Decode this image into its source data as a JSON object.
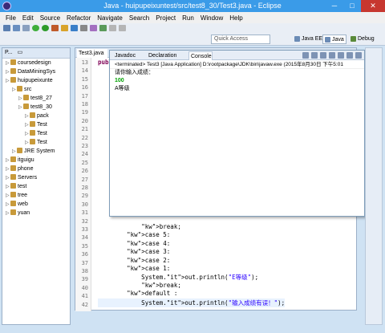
{
  "window": {
    "title": "Java - huipupeixuntest/src/test8_30/Test3.java - Eclipse"
  },
  "menu": [
    "File",
    "Edit",
    "Source",
    "Refactor",
    "Navigate",
    "Search",
    "Project",
    "Run",
    "Window",
    "Help"
  ],
  "quick_access": {
    "placeholder": "Quick Access"
  },
  "perspectives": {
    "java_ee": "Java EE",
    "java": "Java",
    "debug": "Debug"
  },
  "left_panel": {
    "tab": "P...",
    "tree": [
      {
        "label": "coursedesign",
        "indent": 0
      },
      {
        "label": "DataMiningSys",
        "indent": 0
      },
      {
        "label": "huipupeixunte",
        "indent": 0
      },
      {
        "label": "src",
        "indent": 1
      },
      {
        "label": "test8_27",
        "indent": 2
      },
      {
        "label": "test8_30",
        "indent": 2
      },
      {
        "label": "pack",
        "indent": 3
      },
      {
        "label": "Test",
        "indent": 3
      },
      {
        "label": "Test",
        "indent": 3
      },
      {
        "label": "Test",
        "indent": 3
      },
      {
        "label": "JRE System",
        "indent": 1
      },
      {
        "label": "itguigu",
        "indent": 0
      },
      {
        "label": "phone",
        "indent": 0
      },
      {
        "label": "Servers",
        "indent": 0
      },
      {
        "label": "test",
        "indent": 0
      },
      {
        "label": "tree",
        "indent": 0
      },
      {
        "label": "web",
        "indent": 0
      },
      {
        "label": "yuan",
        "indent": 0
      }
    ]
  },
  "editor": {
    "tab": "Test3.java",
    "top_line_num": "13",
    "top_code": "publ",
    "line_numbers": [
      "13",
      "14",
      "15",
      "16",
      "17",
      "18",
      "19",
      "20",
      "21",
      "22",
      "23",
      "24",
      "25",
      "26",
      "27",
      "28",
      "29",
      "30",
      "31",
      "32",
      "33",
      "34",
      "35",
      "36",
      "37",
      "38",
      "39",
      "40",
      "41",
      "42"
    ],
    "lines": [
      {
        "num": "33",
        "code": "            break;"
      },
      {
        "num": "34",
        "code": "        case 5:"
      },
      {
        "num": "35",
        "code": "        case 4:"
      },
      {
        "num": "36",
        "code": "        case 3:"
      },
      {
        "num": "37",
        "code": "        case 2:"
      },
      {
        "num": "38",
        "code": "        case 1:"
      },
      {
        "num": "39",
        "code": "            System.out.println(\"E等级\");"
      },
      {
        "num": "40",
        "code": "            break;"
      },
      {
        "num": "41",
        "code": "        default :"
      },
      {
        "num": "42",
        "code": "            System.out.println(\"输入成绩有误！\");"
      }
    ]
  },
  "console": {
    "tabs": [
      "Javadoc",
      "Declaration",
      "Console"
    ],
    "status": "<terminated> Test3 [Java Application] D:\\rootpackage\\JDK\\bin\\javaw.exe (2015年8月30日 下午5:01",
    "output": [
      "请你输入成绩：",
      "100",
      "A等级"
    ]
  }
}
